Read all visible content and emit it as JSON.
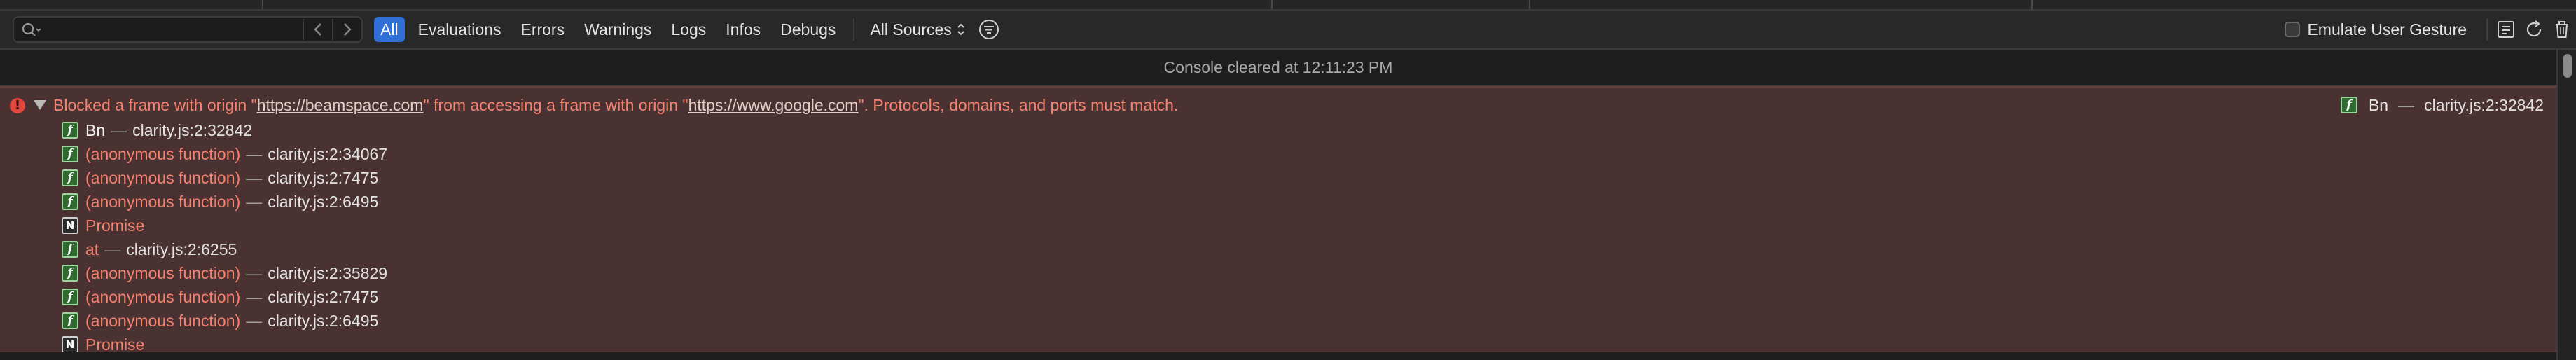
{
  "toolbar": {
    "search_placeholder": "",
    "filters": [
      {
        "label": "All",
        "active": true
      },
      {
        "label": "Evaluations",
        "active": false
      },
      {
        "label": "Errors",
        "active": false
      },
      {
        "label": "Warnings",
        "active": false
      },
      {
        "label": "Logs",
        "active": false
      },
      {
        "label": "Infos",
        "active": false
      },
      {
        "label": "Debugs",
        "active": false
      }
    ],
    "sources_label": "All Sources",
    "emulate_label": "Emulate User Gesture",
    "emulate_checked": false
  },
  "console": {
    "cleared_text": "Console cleared at 12:11:23 PM",
    "error": {
      "prefix": "Blocked a frame with origin \"",
      "origin1": "https://beamspace.com",
      "middle": "\" from accessing a frame with origin \"",
      "origin2": "https://www.google.com",
      "suffix": "\". Protocols, domains, and ports must match.",
      "source_func": "Bn",
      "source_loc": "clarity.js:2:32842"
    },
    "frames": [
      {
        "badge": "f",
        "name": "Bn",
        "loc": "clarity.js:2:32842"
      },
      {
        "badge": "f",
        "name": "(anonymous function)",
        "loc": "clarity.js:2:34067"
      },
      {
        "badge": "f",
        "name": "(anonymous function)",
        "loc": "clarity.js:2:7475"
      },
      {
        "badge": "f",
        "name": "(anonymous function)",
        "loc": "clarity.js:2:6495"
      },
      {
        "badge": "N",
        "name": "Promise",
        "loc": ""
      },
      {
        "badge": "f",
        "name": "at",
        "loc": "clarity.js:2:6255"
      },
      {
        "badge": "f",
        "name": "(anonymous function)",
        "loc": "clarity.js:2:35829"
      },
      {
        "badge": "f",
        "name": "(anonymous function)",
        "loc": "clarity.js:2:7475"
      },
      {
        "badge": "f",
        "name": "(anonymous function)",
        "loc": "clarity.js:2:6495"
      },
      {
        "badge": "N",
        "name": "Promise",
        "loc": ""
      }
    ]
  },
  "colors": {
    "error_bg": "#4b3232",
    "error_text": "#f4826f",
    "accent": "#2f6fd6"
  },
  "icons": [
    "search-icon",
    "back-arrow-icon",
    "forward-arrow-icon",
    "chevron-updown-icon",
    "filter-icon",
    "console-log-icon",
    "reload-icon",
    "trash-icon",
    "error-icon",
    "function-badge-icon",
    "native-badge-icon"
  ]
}
